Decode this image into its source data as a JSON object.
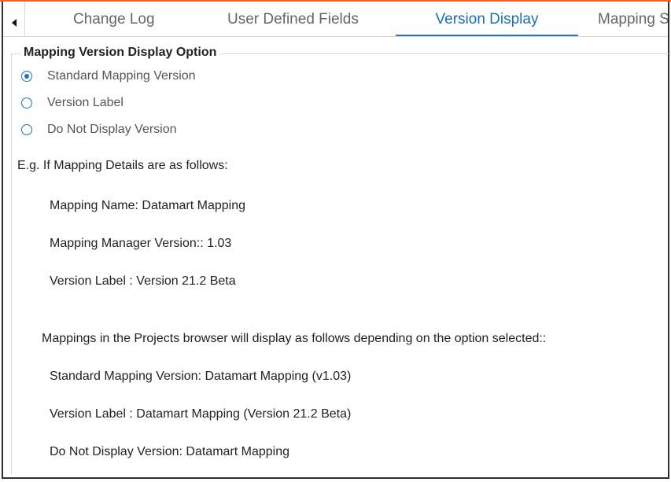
{
  "tabs": [
    {
      "label": "Change Log",
      "active": false
    },
    {
      "label": "User Defined Fields",
      "active": false
    },
    {
      "label": "Version Display",
      "active": true
    },
    {
      "label": "Mapping S",
      "active": false
    }
  ],
  "group": {
    "title": "Mapping Version Display Option",
    "options": [
      {
        "label": "Standard Mapping Version",
        "selected": true
      },
      {
        "label": "Version Label",
        "selected": false
      },
      {
        "label": "Do Not Display Version",
        "selected": false
      }
    ]
  },
  "example": {
    "intro": "E.g. If Mapping Details are as follows:",
    "details": [
      "Mapping Name: Datamart Mapping",
      "Mapping Manager Version:: 1.03",
      "Version Label : Version 21.2 Beta"
    ],
    "display_intro": "Mappings in the Projects browser will display as follows depending on the option selected::",
    "display_results": [
      "Standard Mapping Version: Datamart Mapping (v1.03)",
      "Version Label : Datamart Mapping (Version 21.2 Beta)",
      "Do Not Display Version: Datamart Mapping"
    ]
  },
  "colors": {
    "accent_top": "#e8632a",
    "active_tab": "#1b6fb3",
    "radio": "#1e74b9"
  },
  "icons": {
    "tab_scroll": "triangle-left-icon"
  }
}
